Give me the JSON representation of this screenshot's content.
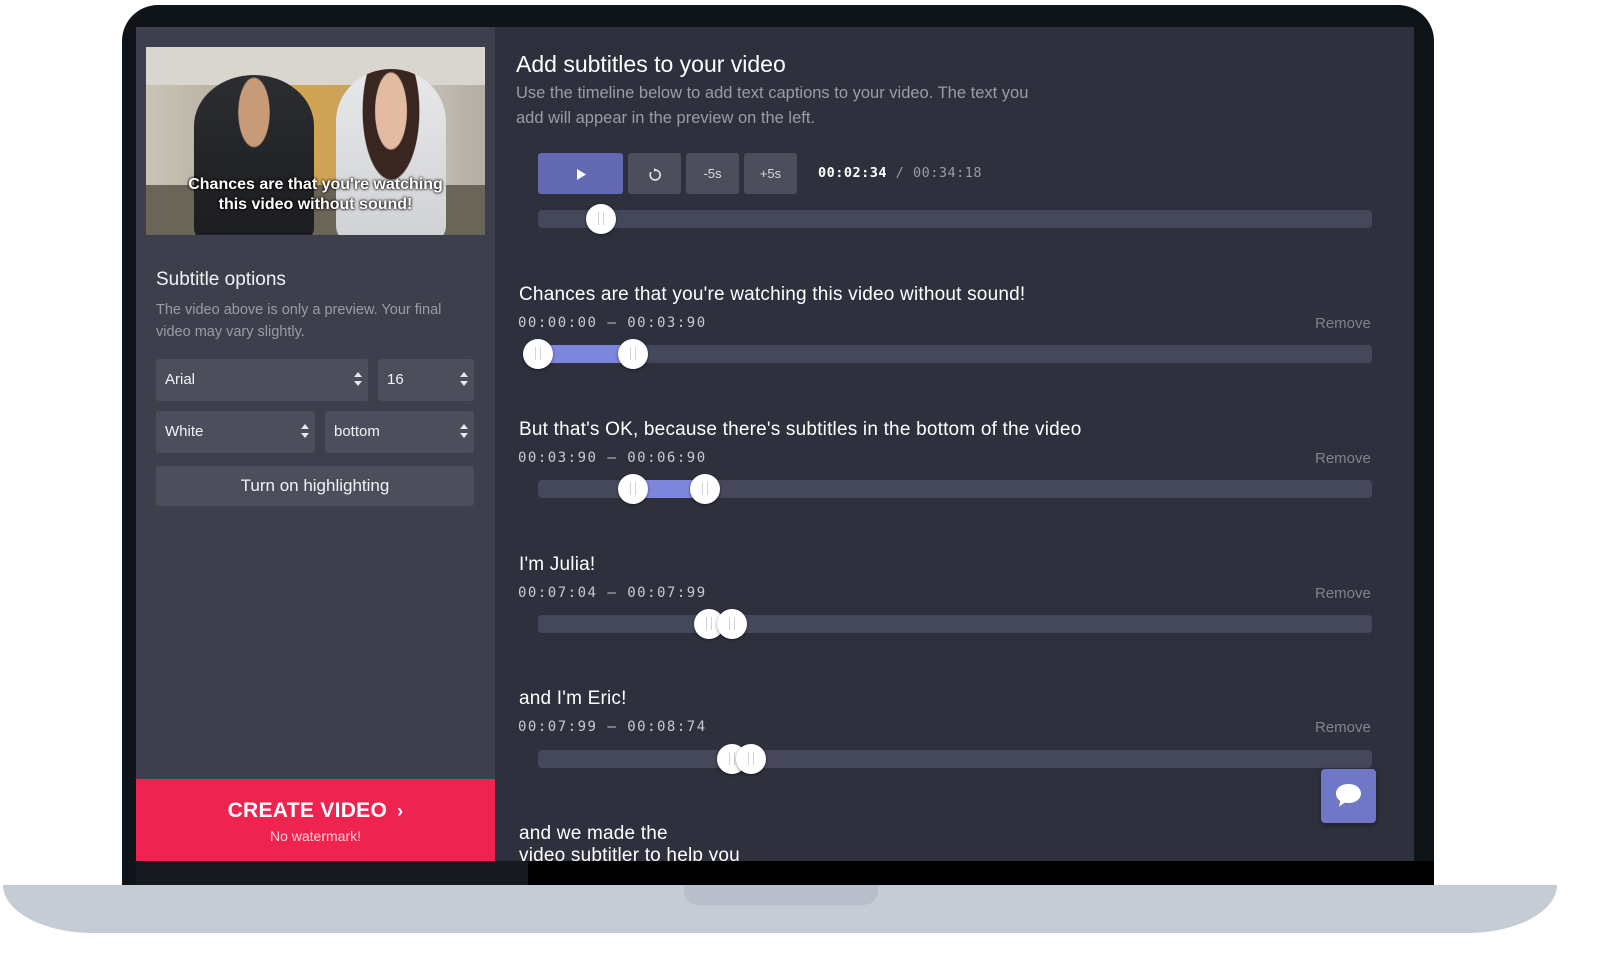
{
  "left_panel": {
    "preview_caption_line1": "Chances are that you're watching",
    "preview_caption_line2": "this video without sound!",
    "options_title": "Subtitle options",
    "options_desc": "The video above is only a preview. Your final video may vary slightly.",
    "font_select": "Arial",
    "size_select": "16",
    "color_select": "White",
    "position_select": "bottom",
    "highlight_button": "Turn on highlighting",
    "create_button": "CREATE VIDEO",
    "create_sub": "No watermark!"
  },
  "main": {
    "title": "Add subtitles to your video",
    "description": "Use the timeline below to add text captions to your video. The text you add will appear in the preview on the left.",
    "controls": {
      "play_icon": "play-icon",
      "reset_icon": "rotate-icon",
      "back_label": "-5s",
      "forward_label": "+5s"
    },
    "current_time": "00:02:34",
    "separator": "/",
    "total_time": "00:34:18",
    "playhead_fraction": 0.075
  },
  "subtitles": [
    {
      "text": "Chances are that you're watching this video without sound!",
      "range": "00:00:00 – 00:03:90",
      "remove": "Remove",
      "start_fraction": 0.0,
      "end_fraction": 0.114
    },
    {
      "text": "But that's OK, because there's subtitles in the bottom of the video",
      "range": "00:03:90 – 00:06:90",
      "remove": "Remove",
      "start_fraction": 0.114,
      "end_fraction": 0.2
    },
    {
      "text": "I'm Julia!",
      "range": "00:07:04 – 00:07:99",
      "remove": "Remove",
      "start_fraction": 0.205,
      "end_fraction": 0.233
    },
    {
      "text": "and I'm Eric!",
      "range": "00:07:99 – 00:08:74",
      "remove": "Remove",
      "start_fraction": 0.233,
      "end_fraction": 0.255
    },
    {
      "text_line1": "and we made the",
      "text_line2": "video subtitler to help you"
    }
  ],
  "icons": {
    "chat": "chat-bubble-icon",
    "chevron": "chevron-right-icon"
  },
  "colors": {
    "accent": "#6469b4",
    "range_fill": "#7f86dd",
    "create": "#ee2350"
  }
}
